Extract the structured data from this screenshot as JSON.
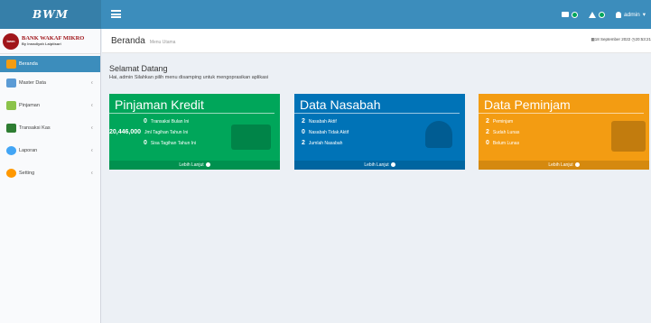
{
  "brand": "BWM",
  "navbar": {
    "user": "admin"
  },
  "logo": {
    "badge": "bwm",
    "title": "BANK WAKAF MIKRO",
    "subtitle": "By Innadiyah Laiptisari"
  },
  "sidebar": {
    "items": [
      {
        "label": "Beranda"
      },
      {
        "label": "Master Data"
      },
      {
        "label": "Pinjaman"
      },
      {
        "label": "Transaksi Kas"
      },
      {
        "label": "Laporan"
      },
      {
        "label": "Setting"
      }
    ]
  },
  "header": {
    "title": "Beranda",
    "subtitle": "Menu Utama",
    "date": "18 September 2022",
    "time": "20:53:21"
  },
  "welcome": {
    "title": "Selamat Datang",
    "text": "Hai, admin Silahkan pilih menu disamping untuk mengoprasikan aplikasi"
  },
  "boxes": {
    "pinjaman": {
      "title": "Pinjaman Kredit",
      "lines": [
        {
          "value": "0",
          "label": "Transaksi Bulan Ini"
        },
        {
          "value": "20,446,000",
          "label": "Jml Tagihan Tahun Ini"
        },
        {
          "value": "0",
          "label": "Sisa Tagihan Tahun Ini"
        }
      ],
      "footer": "Lebih Lanjut"
    },
    "nasabah": {
      "title": "Data Nasabah",
      "lines": [
        {
          "value": "2",
          "label": "Nasabah Aktif"
        },
        {
          "value": "0",
          "label": "Nasabah Tidak Aktif"
        },
        {
          "value": "2",
          "label": "Jumlah Nasabah"
        }
      ],
      "footer": "Lebih Lanjut"
    },
    "peminjam": {
      "title": "Data Peminjam",
      "lines": [
        {
          "value": "2",
          "label": "Peminjam"
        },
        {
          "value": "2",
          "label": "Sudah Lunas"
        },
        {
          "value": "0",
          "label": "Belum Lunas"
        }
      ],
      "footer": "Lebih Lanjut"
    }
  },
  "colors": {
    "primary": "#3c8dbc",
    "green": "#00a65a",
    "blue": "#0073b7",
    "orange": "#f39c12"
  }
}
